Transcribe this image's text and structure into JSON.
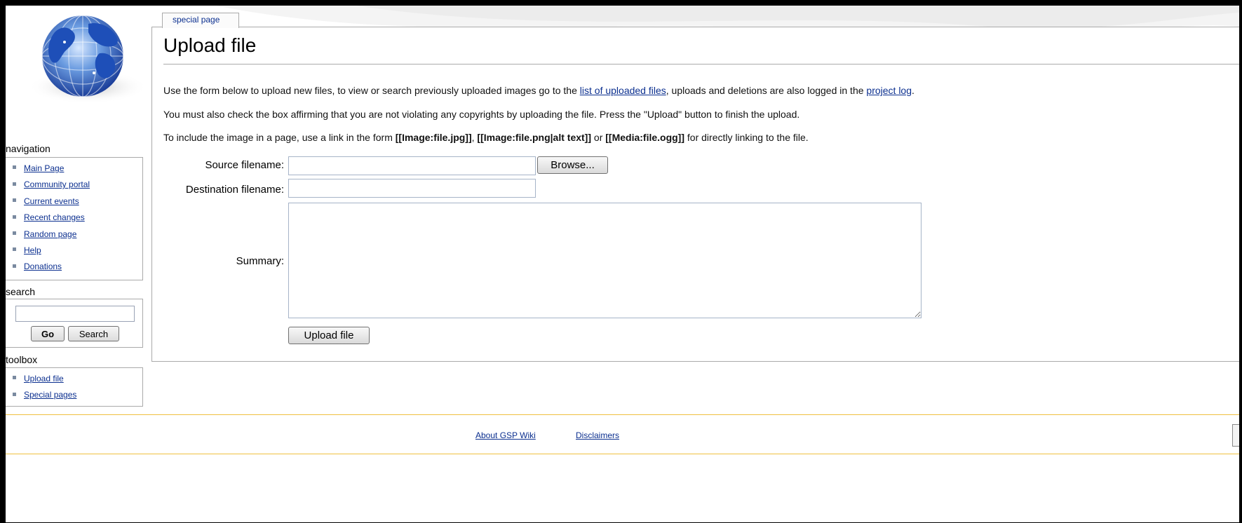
{
  "tab": {
    "label": "special page"
  },
  "page": {
    "title": "Upload file",
    "intro1": {
      "before": "Use the form below to upload new files, to view or search previously uploaded images go to the ",
      "link1": "list of uploaded files",
      "middle": ", uploads and deletions are also logged in the ",
      "link2": "project log",
      "after": "."
    },
    "intro2": "You must also check the box affirming that you are not violating any copyrights by uploading the file. Press the \"Upload\" button to finish the upload.",
    "intro3": {
      "before": "To include the image in a page, use a link in the form ",
      "code1": "[[Image:file.jpg]]",
      "sep1": ", ",
      "code2": "[[Image:file.png|alt text]]",
      "sep2": " or ",
      "code3": "[[Media:file.ogg]]",
      "after": " for directly linking to the file."
    }
  },
  "form": {
    "source_label": "Source filename:",
    "source_value": "",
    "browse_label": "Browse...",
    "dest_label": "Destination filename:",
    "dest_value": "",
    "summary_label": "Summary:",
    "summary_value": "",
    "upload_label": "Upload file"
  },
  "sidebar": {
    "navigation": {
      "title": "navigation",
      "items": [
        "Main Page",
        "Community portal",
        "Current events",
        "Recent changes",
        "Random page",
        "Help",
        "Donations"
      ]
    },
    "search": {
      "title": "search",
      "value": "",
      "go_label": "Go",
      "search_label": "Search"
    },
    "toolbox": {
      "title": "toolbox",
      "items": [
        "Upload file",
        "Special pages"
      ]
    }
  },
  "footer": {
    "links": [
      "About GSP Wiki",
      "Disclaimers"
    ]
  },
  "colors": {
    "link": "#0b2f8f",
    "border": "#aaaaaa",
    "footer_rule": "#f0c040",
    "globe_blue": "#2a63c8"
  },
  "icons": {
    "logo": "globe-logo-icon",
    "bullet": "square-bullet-icon"
  }
}
